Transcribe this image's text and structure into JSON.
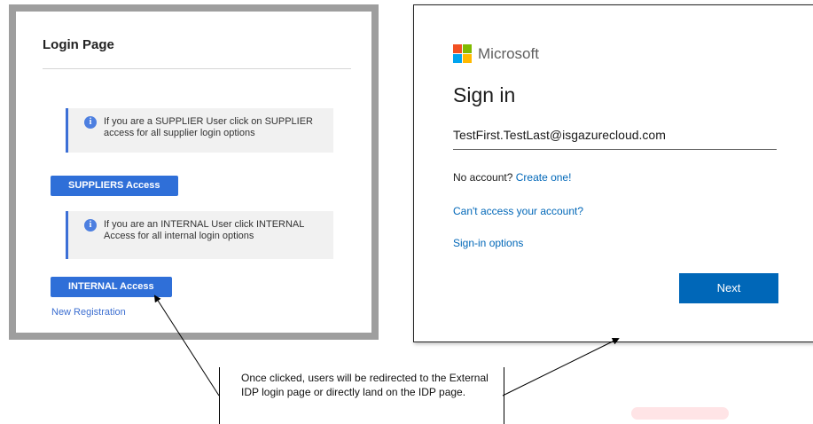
{
  "login_panel": {
    "title": "Login Page",
    "supplier_info": "If you are a SUPPLIER User click on SUPPLIER access for all supplier login options",
    "suppliers_button": "SUPPLIERS Access",
    "internal_info": "If you are an INTERNAL User click INTERNAL Access for all internal login options",
    "internal_button": "INTERNAL Access",
    "new_registration": "New Registration",
    "info_icon": "info-icon",
    "accent_color": "#2f6fd8"
  },
  "microsoft_panel": {
    "brand": "Microsoft",
    "title": "Sign in",
    "email": "TestFirst.TestLast@isgazurecloud.com",
    "no_account_text": "No account?",
    "create_link": "Create one!",
    "cant_access": "Can't access your account?",
    "signin_options": "Sign-in options",
    "next_button": "Next",
    "link_color": "#0067b8"
  },
  "callout": {
    "text": "Once clicked, users will be redirected to the External IDP login page or directly land on the IDP page."
  }
}
